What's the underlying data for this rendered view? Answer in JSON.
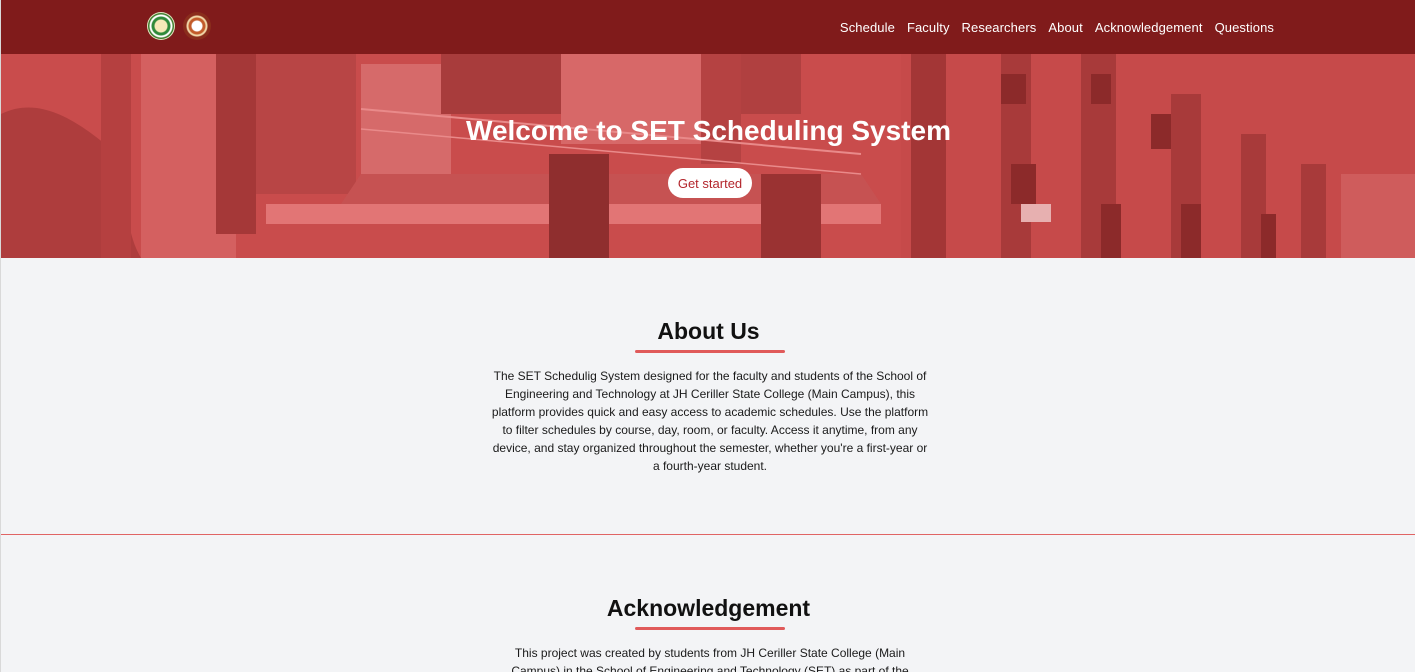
{
  "navbar": {
    "logos": [
      "school-seal",
      "department-seal"
    ],
    "links": [
      {
        "label": "Schedule"
      },
      {
        "label": "Faculty"
      },
      {
        "label": "Researchers"
      },
      {
        "label": "About"
      },
      {
        "label": "Acknowledgement"
      },
      {
        "label": "Questions"
      }
    ],
    "background_color": "#801b1b"
  },
  "hero": {
    "title": "Welcome to SET Scheduling System",
    "button_label": "Get started",
    "overlay_color": "#c94c4c"
  },
  "about": {
    "title": "About Us",
    "text": "The SET Schedulig System designed for the faculty and students of the School of Engineering and Technology at JH Ceriller State College (Main Campus), this platform provides quick and easy access to academic schedules. Use the platform to filter schedules by course, day, room, or faculty. Access it anytime, from any device, and stay organized throughout the semester, whether you're a first-year or a fourth-year student."
  },
  "acknowledgement": {
    "title": "Acknowledgement",
    "text": "This project was created by students from JH Ceriller State College (Main Campus) in the School of Engineering and Technology (SET) as part of the"
  },
  "colors": {
    "accent": "#e05a5a",
    "page_background": "#f3f4f6"
  }
}
